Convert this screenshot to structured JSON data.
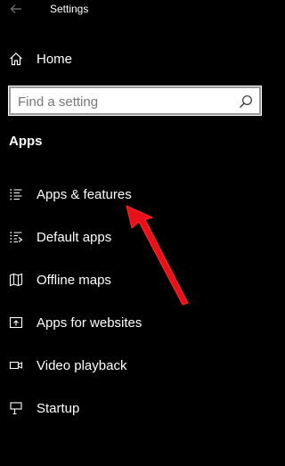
{
  "window": {
    "title": "Settings"
  },
  "home": {
    "label": "Home",
    "icon": "home-icon"
  },
  "search": {
    "placeholder": "Find a setting",
    "value": ""
  },
  "section": {
    "heading": "Apps"
  },
  "nav": {
    "items": [
      {
        "label": "Apps & features",
        "icon": "apps-features-icon"
      },
      {
        "label": "Default apps",
        "icon": "default-apps-icon"
      },
      {
        "label": "Offline maps",
        "icon": "map-icon"
      },
      {
        "label": "Apps for websites",
        "icon": "apps-websites-icon"
      },
      {
        "label": "Video playback",
        "icon": "video-icon"
      },
      {
        "label": "Startup",
        "icon": "startup-icon"
      }
    ]
  },
  "colors": {
    "background": "#000000",
    "text": "#ffffff",
    "annotation_arrow": "#e8111a"
  }
}
